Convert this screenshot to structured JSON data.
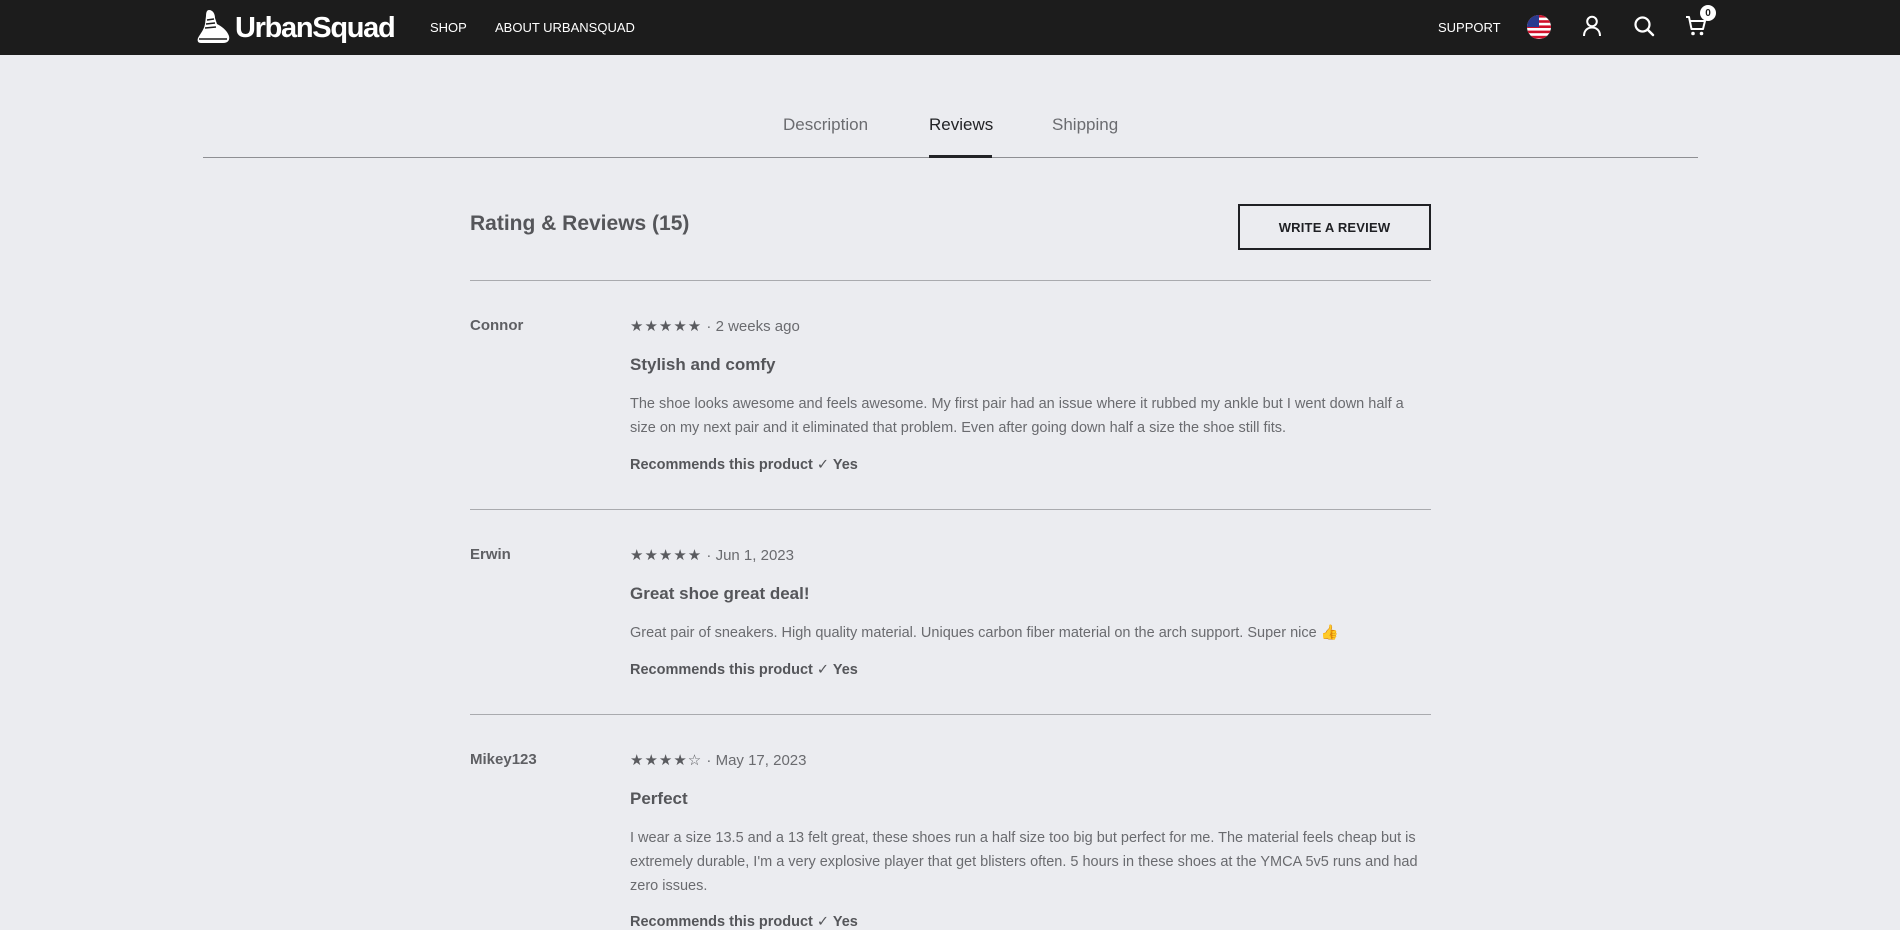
{
  "header": {
    "logo_text": "UrbanSquad",
    "nav": {
      "shop": "SHOP",
      "about": "ABOUT URBANSQUAD",
      "support": "SUPPORT"
    },
    "cart_count": "0",
    "icons": [
      "shoe-logo-icon",
      "us-flag-icon",
      "user-icon",
      "search-icon",
      "cart-icon"
    ]
  },
  "tabs": [
    {
      "label": "Description",
      "active": false
    },
    {
      "label": "Reviews",
      "active": true
    },
    {
      "label": "Shipping",
      "active": false
    }
  ],
  "reviews_section": {
    "title": "Rating & Reviews (15)",
    "write_button": "WRITE A REVIEW",
    "items": [
      {
        "author": "Connor",
        "stars": "★★★★★",
        "rating": 5,
        "date": "· 2 weeks ago",
        "title": "Stylish and comfy",
        "body": "The shoe looks awesome and feels awesome. My first pair had an issue where it rubbed my ankle but I went down half a size on my next pair and it eliminated that problem. Even after going down half a size the shoe still fits.",
        "recommend": "Recommends this product ✓ Yes"
      },
      {
        "author": "Erwin",
        "stars": "★★★★★",
        "rating": 5,
        "date": "· Jun 1, 2023",
        "title": "Great shoe great deal!",
        "body": "Great pair of sneakers. High quality material. Uniques carbon fiber material on the arch support. Super nice 👍",
        "recommend": "Recommends this product ✓ Yes"
      },
      {
        "author": "Mikey123",
        "stars": "★★★★☆",
        "rating": 4,
        "date": "· May 17, 2023",
        "title": "Perfect",
        "body": "I wear a size 13.5 and a 13 felt great, these shoes run a half size too big but perfect for me. The material feels cheap but is extremely durable, I'm a very explosive player that get blisters often. 5 hours in these shoes at the YMCA 5v5 runs and had zero issues.",
        "recommend": "Recommends this product ✓ Yes"
      }
    ]
  }
}
